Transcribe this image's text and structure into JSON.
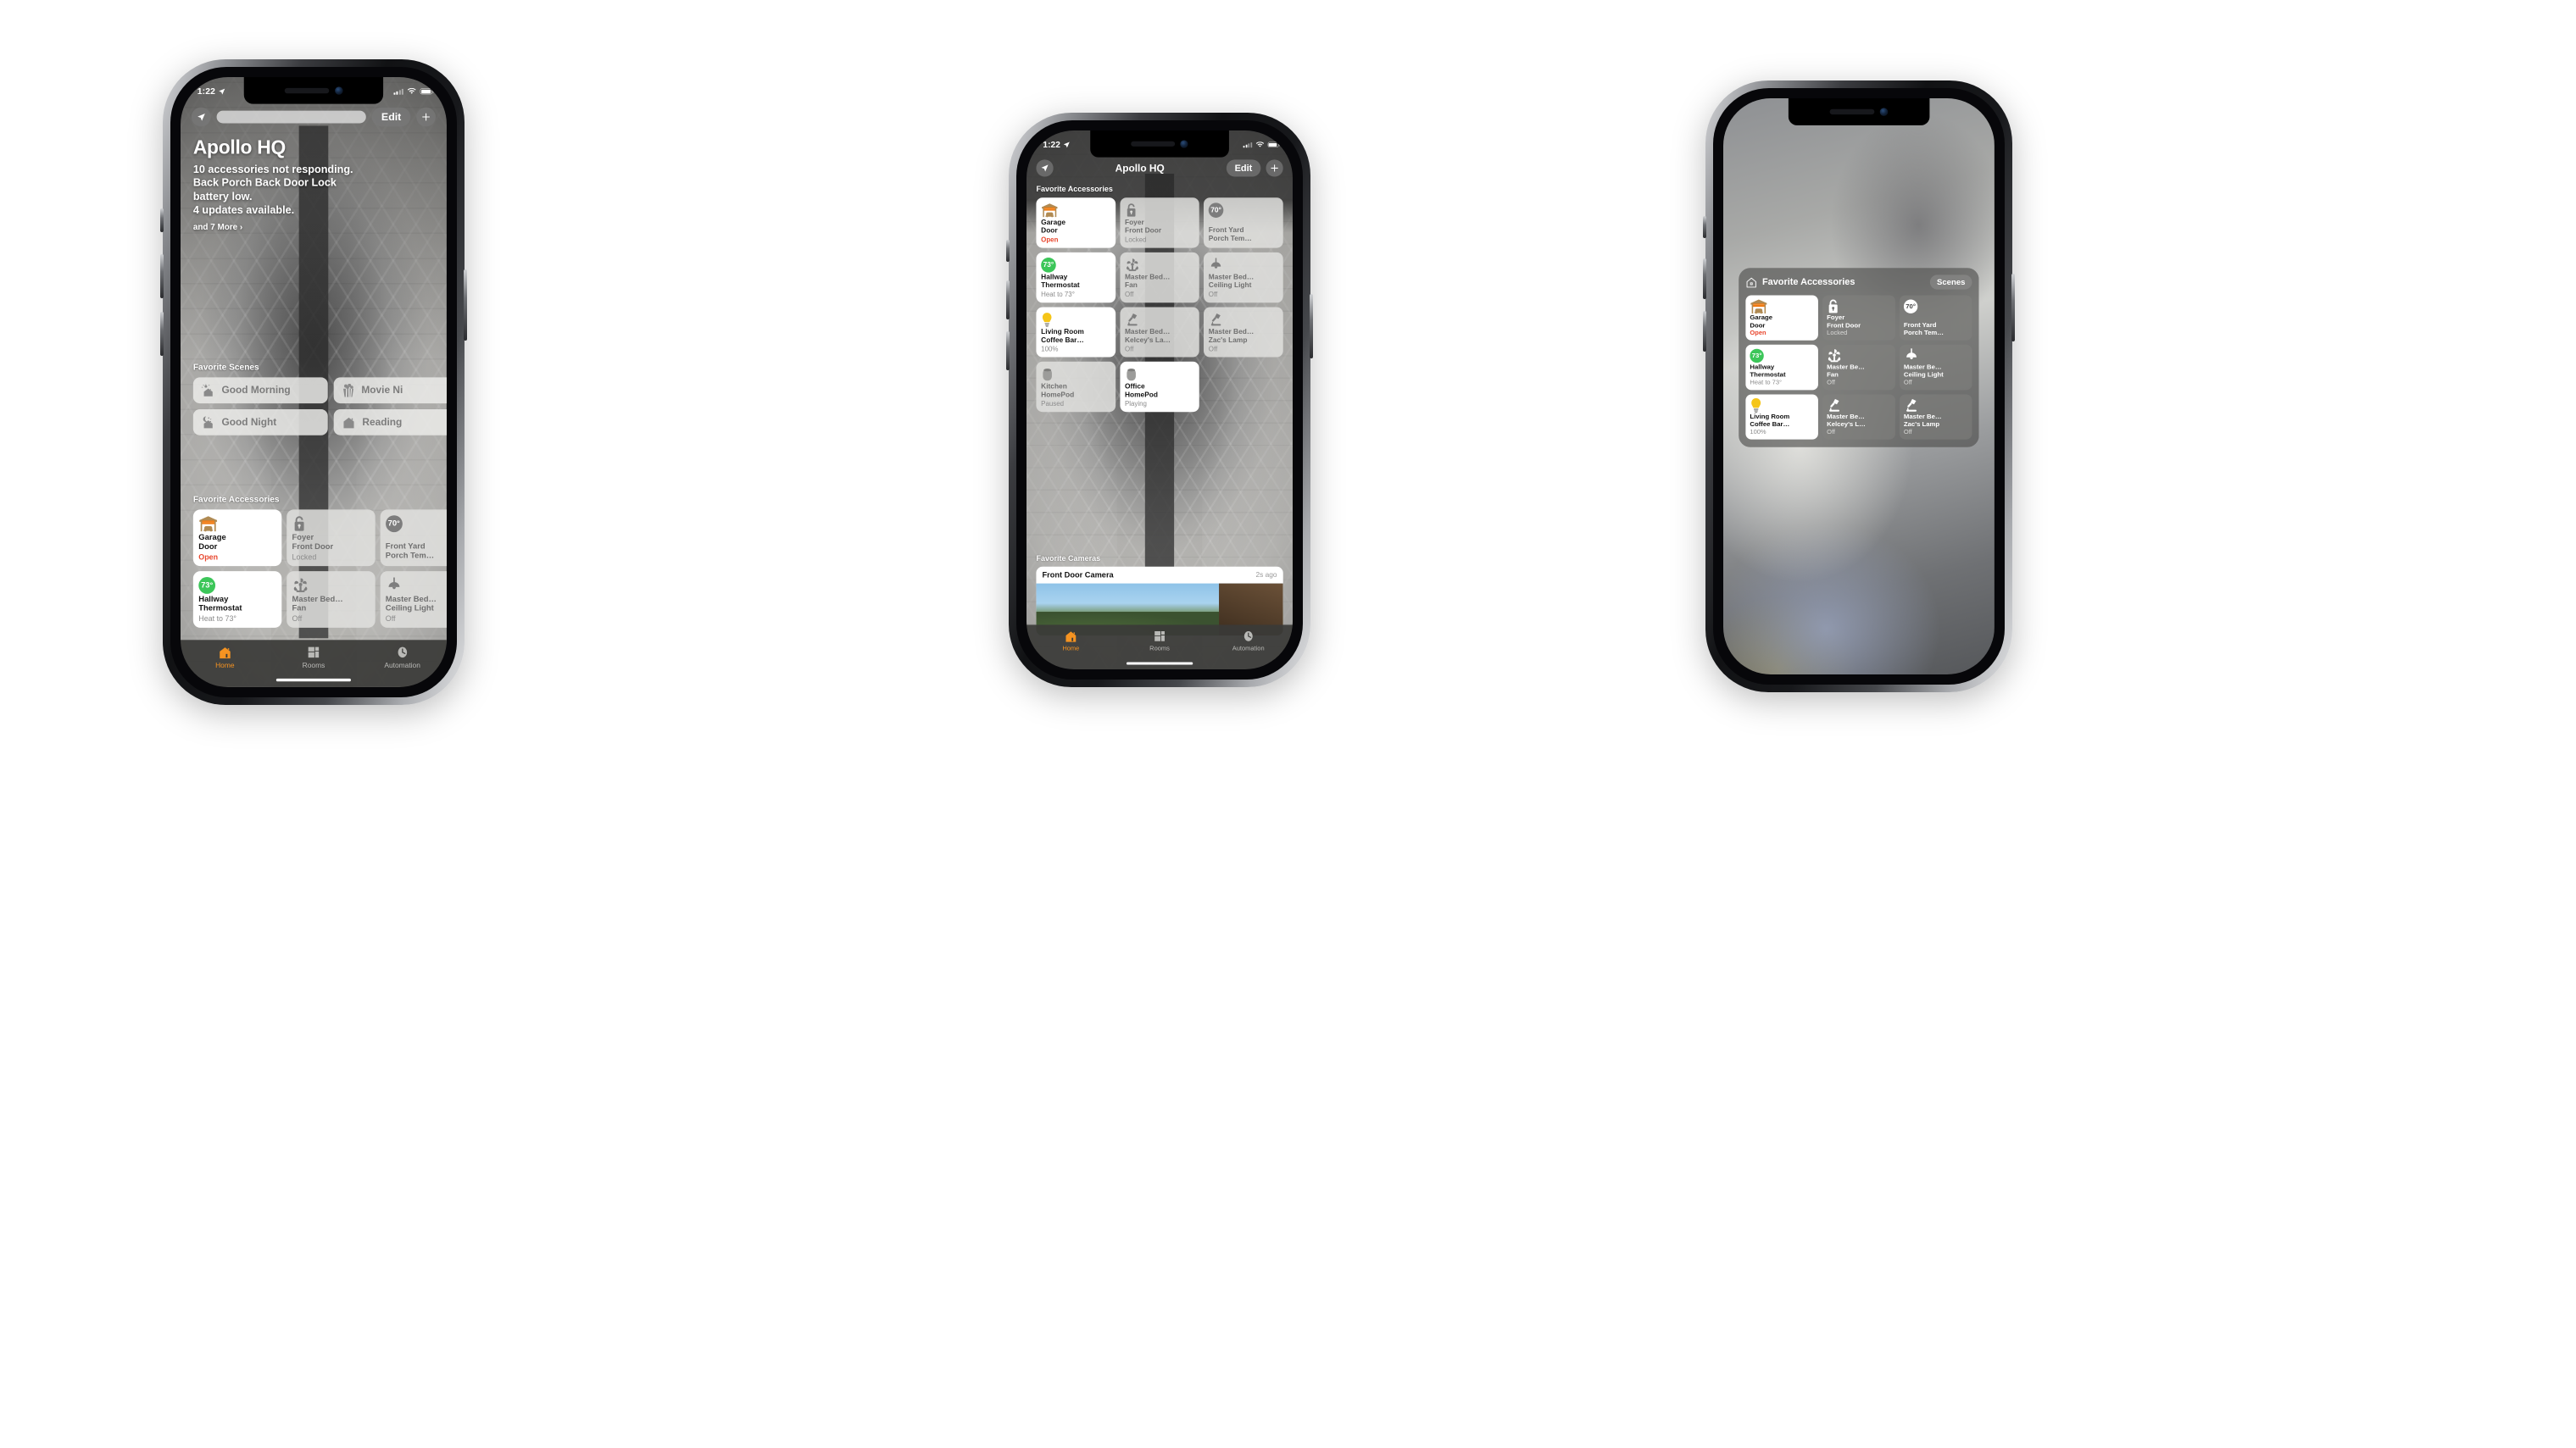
{
  "status_bar": {
    "time": "1:22",
    "location_icon": "location-arrow-icon",
    "cell_icon": "cellular-bars-icon",
    "wifi_icon": "wifi-icon",
    "battery_icon": "battery-icon"
  },
  "phone1": {
    "nav": {
      "location_button": "location-arrow-icon",
      "edit_label": "Edit",
      "add_label": "+",
      "search_placeholder": ""
    },
    "headline": {
      "title": "Apollo HQ",
      "lines": [
        "10 accessories not responding.",
        "Back Porch Back Door Lock",
        "battery low.",
        "4 updates available."
      ],
      "more_label": "and 7 More ›"
    },
    "scenes_header": "Favorite Scenes",
    "scenes": [
      {
        "label": "Good Morning",
        "icon": "sunrise-house-icon"
      },
      {
        "label": "Movie Ni",
        "icon": "popcorn-icon"
      },
      {
        "label": "Good Night",
        "icon": "moon-house-icon"
      },
      {
        "label": "Reading",
        "icon": "house-icon"
      }
    ],
    "accessories_header": "Favorite Accessories",
    "accessories": [
      {
        "name": "Garage",
        "name2": "Door",
        "status": "Open",
        "icon": "garage-door-icon",
        "on": true,
        "alert": true
      },
      {
        "name": "Foyer",
        "name2": "Front Door",
        "status": "Locked",
        "icon": "lock-icon",
        "on": false,
        "alert": false
      },
      {
        "name": "Front Yard",
        "name2": "Porch Tem…",
        "status": "",
        "icon": "temperature-icon",
        "temp": "70°",
        "on": false,
        "alert": false
      },
      {
        "name": "Hallway",
        "name2": "Thermostat",
        "status": "Heat to 73°",
        "icon": "temperature-icon",
        "temp": "73°",
        "on": true,
        "alert": false
      },
      {
        "name": "Master Bed…",
        "name2": "Fan",
        "status": "Off",
        "icon": "fan-icon",
        "on": false,
        "alert": false
      },
      {
        "name": "Master Bed…",
        "name2": "Ceiling Light",
        "status": "Off",
        "icon": "ceiling-light-icon",
        "on": false,
        "alert": false
      }
    ],
    "tabs": [
      {
        "label": "Home",
        "icon": "house-icon",
        "active": true
      },
      {
        "label": "Rooms",
        "icon": "rooms-icon",
        "active": false
      },
      {
        "label": "Automation",
        "icon": "automation-clock-icon",
        "active": false
      }
    ]
  },
  "phone2": {
    "nav": {
      "location_button": "location-arrow-icon",
      "title": "Apollo HQ",
      "edit_label": "Edit",
      "add_label": "+"
    },
    "accessories_header": "Favorite Accessories",
    "accessories": [
      {
        "name": "Garage",
        "name2": "Door",
        "status": "Open",
        "icon": "garage-door-icon",
        "on": true,
        "alert": true
      },
      {
        "name": "Foyer",
        "name2": "Front Door",
        "status": "Locked",
        "icon": "lock-icon",
        "on": false,
        "alert": false
      },
      {
        "name": "Front Yard",
        "name2": "Porch Tem…",
        "status": "",
        "icon": "temperature-icon",
        "temp": "70°",
        "on": false,
        "alert": false
      },
      {
        "name": "Hallway",
        "name2": "Thermostat",
        "status": "Heat to 73°",
        "icon": "temperature-icon",
        "temp": "73°",
        "on": true,
        "alert": false
      },
      {
        "name": "Master Bed…",
        "name2": "Fan",
        "status": "Off",
        "icon": "fan-icon",
        "on": false,
        "alert": false
      },
      {
        "name": "Master Bed…",
        "name2": "Ceiling Light",
        "status": "Off",
        "icon": "ceiling-light-icon",
        "on": false,
        "alert": false
      },
      {
        "name": "Living Room",
        "name2": "Coffee Bar…",
        "status": "100%",
        "icon": "bulb-icon",
        "on": true,
        "alert": false
      },
      {
        "name": "Master Bed…",
        "name2": "Kelcey's La…",
        "status": "Off",
        "icon": "desk-lamp-icon",
        "on": false,
        "alert": false
      },
      {
        "name": "Master Bed…",
        "name2": "Zac's Lamp",
        "status": "Off",
        "icon": "desk-lamp-icon",
        "on": false,
        "alert": false
      },
      {
        "name": "Kitchen",
        "name2": "HomePod",
        "status": "Paused",
        "icon": "homepod-icon",
        "on": false,
        "alert": false
      },
      {
        "name": "Office",
        "name2": "HomePod",
        "status": "Playing",
        "icon": "homepod-icon",
        "on": true,
        "alert": false
      }
    ],
    "cameras_header": "Favorite Cameras",
    "camera": {
      "name": "Front Door Camera",
      "time": "2s ago"
    },
    "tabs": [
      {
        "label": "Home",
        "icon": "house-icon",
        "active": true
      },
      {
        "label": "Rooms",
        "icon": "rooms-icon",
        "active": false
      },
      {
        "label": "Automation",
        "icon": "automation-clock-icon",
        "active": false
      }
    ]
  },
  "phone3": {
    "widget": {
      "home_icon": "home-outline-icon",
      "title": "Favorite Accessories",
      "scenes_label": "Scenes",
      "accessories": [
        {
          "name": "Garage",
          "name2": "Door",
          "status": "Open",
          "icon": "garage-door-icon",
          "on": true,
          "alert": true
        },
        {
          "name": "Foyer",
          "name2": "Front Door",
          "status": "Locked",
          "icon": "lock-icon",
          "on": false,
          "alert": false
        },
        {
          "name": "Front Yard",
          "name2": "Porch Tem…",
          "status": "",
          "icon": "temperature-icon",
          "temp": "70°",
          "on": false,
          "alert": false
        },
        {
          "name": "Hallway",
          "name2": "Thermostat",
          "status": "Heat to 73°",
          "icon": "temperature-icon",
          "temp": "73°",
          "on": true,
          "alert": false
        },
        {
          "name": "Master Be…",
          "name2": "Fan",
          "status": "Off",
          "icon": "fan-icon",
          "on": false,
          "alert": false
        },
        {
          "name": "Master Be…",
          "name2": "Ceiling Light",
          "status": "Off",
          "icon": "ceiling-light-icon",
          "on": false,
          "alert": false
        },
        {
          "name": "Living Room",
          "name2": "Coffee Bar…",
          "status": "100%",
          "icon": "bulb-icon",
          "on": true,
          "alert": false
        },
        {
          "name": "Master Be…",
          "name2": "Kelcey's L…",
          "status": "Off",
          "icon": "desk-lamp-icon",
          "on": false,
          "alert": false
        },
        {
          "name": "Master Be…",
          "name2": "Zac's Lamp",
          "status": "Off",
          "icon": "desk-lamp-icon",
          "on": false,
          "alert": false
        }
      ]
    }
  },
  "colors": {
    "accent_orange": "#f59321",
    "alert_red": "#e8452c",
    "green": "#3cc659",
    "bulb_yellow": "#f5c518"
  }
}
